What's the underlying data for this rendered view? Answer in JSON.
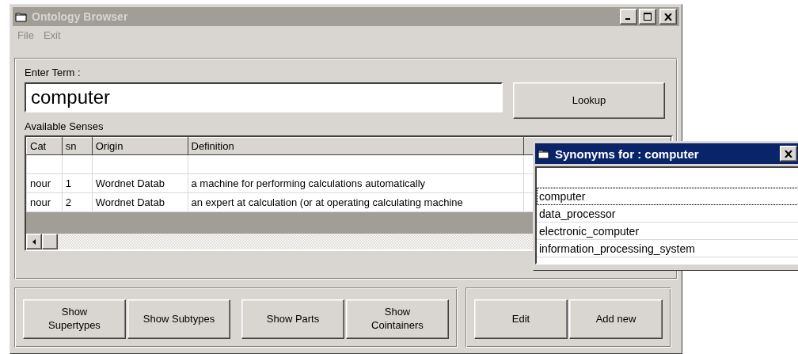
{
  "main_window": {
    "title": "Ontology Browser",
    "active": false,
    "menu": [
      {
        "label": "File",
        "disabled": true
      },
      {
        "label": "Exit",
        "disabled": true
      }
    ],
    "term_label": "Enter Term :",
    "term_value": "computer",
    "lookup_button": "Lookup",
    "senses_label": "Available Senses",
    "senses_table": {
      "columns": [
        "Cat",
        "sn",
        "Origin",
        "Definition"
      ],
      "rows": [
        {
          "cells": [
            "nour",
            "1",
            "Wordnet Datab",
            "a machine for performing calculations automatically"
          ]
        },
        {
          "cells": [
            "nour",
            "2",
            "Wordnet Datab",
            "an expert at calculation (or at operating calculating machine"
          ]
        }
      ]
    },
    "buttons_left": [
      "Show Supertypes",
      "Show Subtypes",
      "Show Parts",
      "Show Cointainers"
    ],
    "buttons_right": [
      "Edit",
      "Add new"
    ]
  },
  "synonyms_window": {
    "title": "Synonyms for : computer",
    "active": true,
    "items": [
      {
        "label": "computer",
        "selected": true
      },
      {
        "label": "data_processor",
        "selected": false
      },
      {
        "label": "electronic_computer",
        "selected": false
      },
      {
        "label": "information_processing_system",
        "selected": false
      }
    ]
  }
}
